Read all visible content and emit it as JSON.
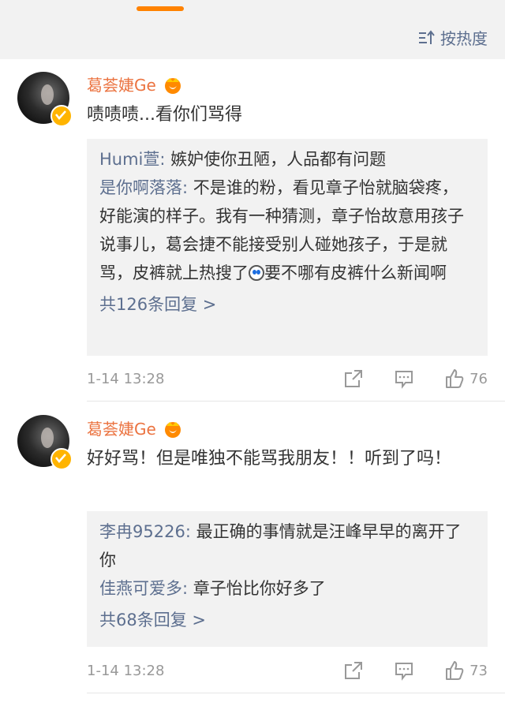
{
  "header": {
    "sort_label": "按热度"
  },
  "comments": [
    {
      "username": "葛荟婕Ge",
      "text": "啧啧啧...看你们骂得",
      "replies": [
        {
          "name": "Humi萱",
          "text": " 嫉妒使你丑陋，人品都有问题"
        },
        {
          "name": "是你啊落落",
          "text": " 不是谁的粉，看见章子怡就脑袋疼，好能演的样子。我有一种猜测，章子怡故意用孩子说事儿，葛会捷不能接受别人碰她孩子，于是就骂，皮裤就上热搜了",
          "text_after": "要不哪有皮裤什么新闻啊"
        }
      ],
      "more_replies": "共126条回复 >",
      "time": "1-14 13:28",
      "likes": "76"
    },
    {
      "username": "葛荟婕Ge",
      "text": "好好骂！但是唯独不能骂我朋友！！听到了吗！",
      "replies": [
        {
          "name": "李冉95226",
          "text": " 最正确的事情就是汪峰早早的离开了你"
        },
        {
          "name": "佳燕可爱多",
          "text": " 章子怡比你好多了"
        }
      ],
      "more_replies": "共68条回复 >",
      "time": "1-14 13:28",
      "likes": "73"
    }
  ],
  "colors": {
    "accent": "#ff8200",
    "link": "#5d6f8f",
    "username": "#eb7340",
    "badge": "#ffb400"
  },
  "icons": [
    "sort-icon",
    "crown-icon",
    "verified-icon",
    "share-icon",
    "comment-icon",
    "like-icon",
    "emoji-icon"
  ]
}
